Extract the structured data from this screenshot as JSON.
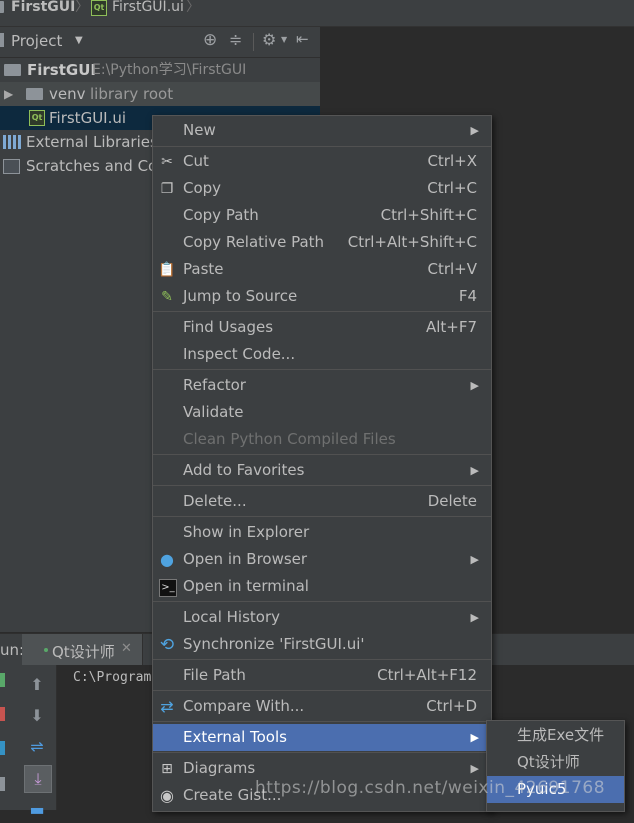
{
  "breadcrumb": {
    "project": "FirstGUI",
    "file": "FirstGUI.ui"
  },
  "project_panel": {
    "title": "Project",
    "tree": [
      {
        "label": "FirstGUI",
        "extra": "E:\\Python学习\\FirstGUI"
      },
      {
        "label": "venv",
        "extra": "library root"
      },
      {
        "label": "FirstGUI.ui",
        "extra": ""
      },
      {
        "label": "External Libraries",
        "extra": ""
      },
      {
        "label": "Scratches and Co",
        "extra": ""
      }
    ]
  },
  "run_panel": {
    "prefix": "un:",
    "tab_label": "Qt设计师",
    "console_text": "C:\\Program"
  },
  "context_menu": {
    "items": [
      {
        "label": "New",
        "shortcut": "",
        "submenu": true
      },
      {
        "label": "Cut",
        "shortcut": "Ctrl+X"
      },
      {
        "label": "Copy",
        "shortcut": "Ctrl+C"
      },
      {
        "label": "Copy Path",
        "shortcut": "Ctrl+Shift+C"
      },
      {
        "label": "Copy Relative Path",
        "shortcut": "Ctrl+Alt+Shift+C"
      },
      {
        "label": "Paste",
        "shortcut": "Ctrl+V"
      },
      {
        "label": "Jump to Source",
        "shortcut": "F4"
      },
      {
        "label": "Find Usages",
        "shortcut": "Alt+F7"
      },
      {
        "label": "Inspect Code...",
        "shortcut": ""
      },
      {
        "label": "Refactor",
        "shortcut": "",
        "submenu": true
      },
      {
        "label": "Validate",
        "shortcut": ""
      },
      {
        "label": "Clean Python Compiled Files",
        "shortcut": "",
        "disabled": true
      },
      {
        "label": "Add to Favorites",
        "shortcut": "",
        "submenu": true
      },
      {
        "label": "Delete...",
        "shortcut": "Delete"
      },
      {
        "label": "Show in Explorer",
        "shortcut": ""
      },
      {
        "label": "Open in Browser",
        "shortcut": "",
        "submenu": true
      },
      {
        "label": "Open in terminal",
        "shortcut": ""
      },
      {
        "label": "Local History",
        "shortcut": "",
        "submenu": true
      },
      {
        "label": "Synchronize 'FirstGUI.ui'",
        "shortcut": ""
      },
      {
        "label": "File Path",
        "shortcut": "Ctrl+Alt+F12"
      },
      {
        "label": "Compare With...",
        "shortcut": "Ctrl+D"
      },
      {
        "label": "External Tools",
        "shortcut": "",
        "submenu": true,
        "active": true
      },
      {
        "label": "Diagrams",
        "shortcut": "",
        "submenu": true
      },
      {
        "label": "Create Gist...",
        "shortcut": ""
      }
    ]
  },
  "submenu": {
    "items": [
      {
        "label": "生成Exe文件"
      },
      {
        "label": "Qt设计师"
      },
      {
        "label": "Pyuic5",
        "active": true
      }
    ]
  },
  "watermark": "https://blog.csdn.net/weixin_42691768",
  "colors": {
    "menu_bg": "#3c3f41",
    "selection": "#4b6eaf",
    "editor_bg": "#2b2b2b"
  }
}
